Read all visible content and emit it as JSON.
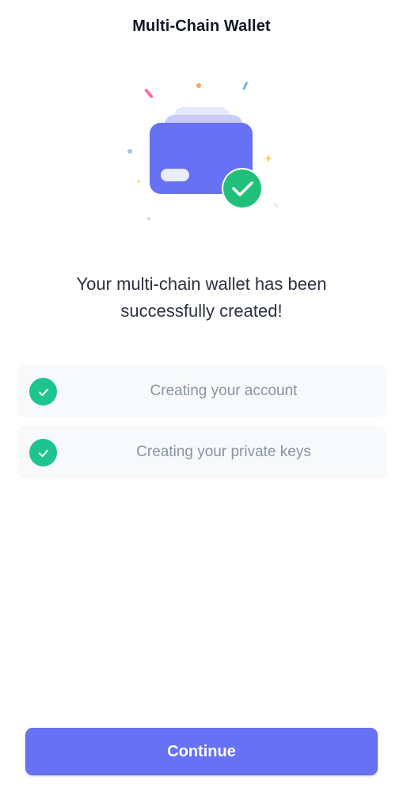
{
  "header": {
    "title": "Multi-Chain Wallet"
  },
  "illustration": {
    "icon": "wallet-success-icon",
    "wallet_color": "#6671f4",
    "check_color": "#21c07a"
  },
  "main": {
    "headline": "Your multi-chain wallet has been successfully created!"
  },
  "steps": [
    {
      "label": "Creating your account",
      "status": "done",
      "icon": "check-circle-icon"
    },
    {
      "label": "Creating your private keys",
      "status": "done",
      "icon": "check-circle-icon"
    }
  ],
  "footer": {
    "continue_label": "Continue"
  },
  "colors": {
    "accent": "#6671f4",
    "success": "#1ec48e",
    "muted_text": "#8a93a3",
    "step_background": "#f7f9fb"
  }
}
